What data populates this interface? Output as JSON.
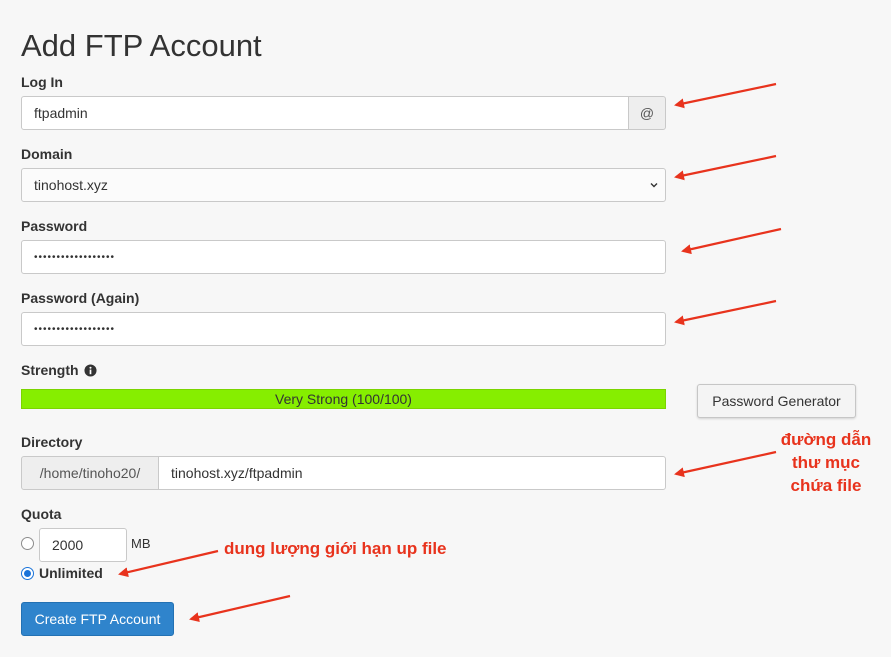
{
  "page": {
    "title": "Add FTP Account"
  },
  "login": {
    "label": "Log In",
    "value": "ftpadmin",
    "addon": "@"
  },
  "domain": {
    "label": "Domain",
    "selected": "tinohost.xyz"
  },
  "password": {
    "label": "Password",
    "mask": "••••••••••••••••••"
  },
  "password_again": {
    "label": "Password (Again)",
    "mask": "••••••••••••••••••"
  },
  "strength": {
    "label": "Strength",
    "bar_text": "Very Strong (100/100)",
    "score": 100,
    "max": 100,
    "color": "#86ee00"
  },
  "generator": {
    "label": "Password Generator"
  },
  "directory": {
    "label": "Directory",
    "prefix": "/home/tinoho20/",
    "value": "tinohost.xyz/ftpadmin"
  },
  "quota": {
    "label": "Quota",
    "value": "2000",
    "unit": "MB",
    "unlimited_label": "Unlimited",
    "unlimited_selected": true
  },
  "submit": {
    "label": "Create FTP Account",
    "color": "#2f84cc"
  },
  "annotations": {
    "directory_note": "đường dẫn thư mục chứa file",
    "quota_note": "dung lượng giới hạn up file",
    "color": "#e8331d"
  },
  "icons": {
    "info": "info-circle-icon",
    "chevron": "chevron-down-icon",
    "arrow": "red-arrow-icon"
  }
}
